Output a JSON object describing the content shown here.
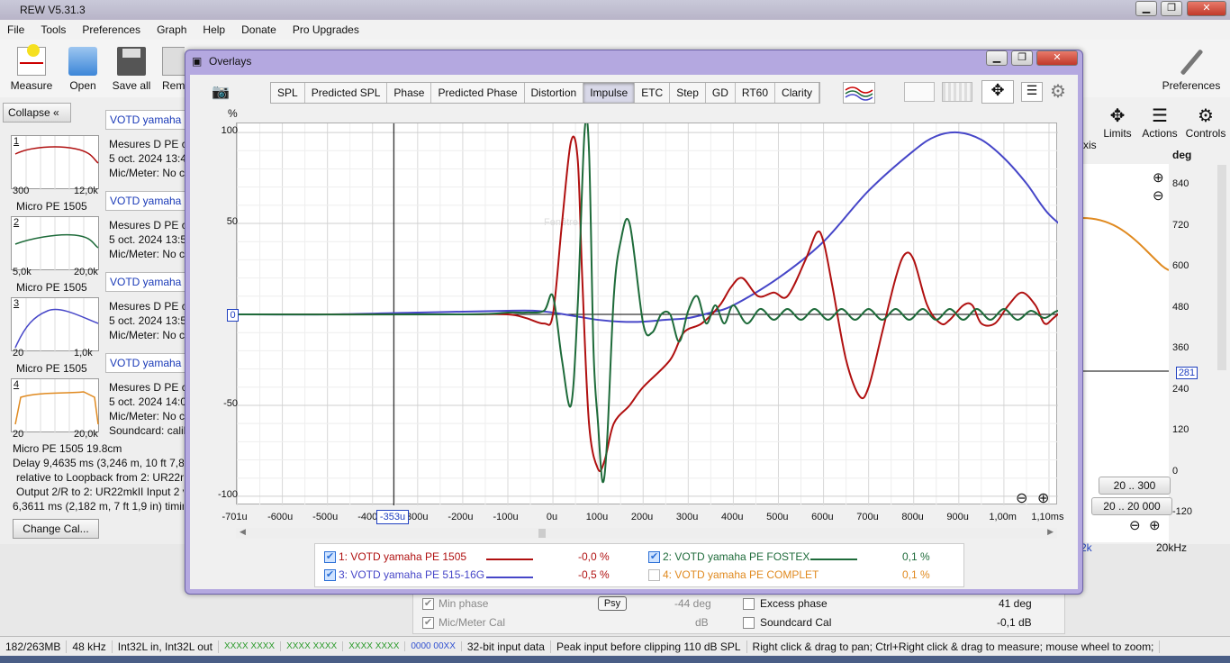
{
  "window": {
    "title": "REW V5.31.3"
  },
  "menu": [
    "File",
    "Tools",
    "Preferences",
    "Graph",
    "Help",
    "Donate",
    "Pro Upgrades"
  ],
  "toolbar": {
    "measure": "Measure",
    "open": "Open",
    "saveall": "Save all",
    "rem": "Rem",
    "preferences": "Preferences",
    "axis": "xis",
    "limits": "Limits",
    "actions": "Actions",
    "controls": "Controls"
  },
  "left": {
    "collapse": "Collapse",
    "measurements": [
      {
        "tab": "VOTD yamaha P",
        "num": "1",
        "l1": "Mesures D PE co",
        "l2": "5 oct. 2024 13:49",
        "l3": "Mic/Meter: No c",
        "lo": "300",
        "hi": "12,0k",
        "name": "Micro PE 1505"
      },
      {
        "tab": "VOTD yamaha P",
        "num": "2",
        "l1": "Mesures D PE co",
        "l2": "5 oct. 2024 13:50",
        "l3": "Mic/Meter: No c",
        "lo": "5,0k",
        "hi": "20,0k",
        "name": "Micro PE 1505"
      },
      {
        "tab": "VOTD yamaha P",
        "num": "3",
        "l1": "Mesures D PE co",
        "l2": "5 oct. 2024 13:55",
        "l3": "Mic/Meter: No c",
        "lo": "20",
        "hi": "1,0k",
        "name": "Micro PE 1505"
      },
      {
        "tab": "VOTD yamaha P",
        "num": "4",
        "l1": "Mesures D PE co",
        "l2": "5 oct. 2024 14:09",
        "l3": "Mic/Meter: No c",
        "l4": "Soundcard: calib",
        "lo": "20",
        "hi": "20,0k",
        "name": ""
      }
    ],
    "micinfo": [
      "Micro PE 1505 19.8cm",
      "Delay 9,4635 ms (3,246 m, 10 ft 7,8 in)",
      "relative to Loopback from 2: UR22mk",
      "Output 2/R to 2: UR22mkII Input 2 v",
      "6,3611 ms (2,182 m, 7 ft 1,9 in) timing"
    ],
    "changecal": "Change Cal..."
  },
  "overlay": {
    "title": "Overlays",
    "tabs": [
      "SPL",
      "Predicted SPL",
      "Phase",
      "Predicted Phase",
      "Distortion",
      "Impulse",
      "ETC",
      "Step",
      "GD",
      "RT60",
      "Clarity"
    ],
    "selected_tab": "Impulse",
    "yunit": "%",
    "unit_select": "%",
    "cursor_label": "-353u",
    "zero_marker": "0",
    "watermark": "Fenêtre"
  },
  "right": {
    "deg": "deg",
    "ticks": [
      "840",
      "720",
      "600",
      "480",
      "360",
      "240",
      "120",
      "0",
      "-120"
    ],
    "marker": "281",
    "range1": "20 .. 300",
    "range2": "20 .. 20 000",
    "hz": "20kHz",
    "k": "2k"
  },
  "bottom": {
    "minphase": "Min phase",
    "psy": "Psy",
    "mp_val": "-44 deg",
    "excess": "Excess phase",
    "ex_val": "41 deg",
    "miccal": "Mic/Meter Cal",
    "db": "dB",
    "soundcard": "Soundcard Cal",
    "sc_val": "-0,1 dB"
  },
  "status": [
    "182/263MB",
    "48 kHz",
    "Int32L in, Int32L out",
    "XXXX XXXX",
    "XXXX XXXX",
    "XXXX XXXX",
    "0000 00XX",
    "32-bit input data",
    "Peak input before clipping 110 dB SPL",
    "Right click & drag to pan; Ctrl+Right click & drag to measure; mouse wheel to zoom;"
  ],
  "colors": {
    "s1": "#b01010",
    "s2": "#1e6b3a",
    "s3": "#4646c8",
    "s4": "#e08a20",
    "status_green": "#2a9a2a",
    "status_blue": "#3050d0"
  },
  "chart_data": {
    "type": "line",
    "xlabel": "",
    "ylabel": "%",
    "xlim": [
      -0.000701,
      0.00112
    ],
    "ylim": [
      -105,
      105
    ],
    "xticks": [
      "-701u",
      "-600u",
      "-500u",
      "-400u",
      "-353u",
      "-300u",
      "-200u",
      "-100u",
      "0u",
      "100u",
      "200u",
      "300u",
      "400u",
      "500u",
      "600u",
      "700u",
      "800u",
      "900u",
      "1,00m",
      "1,10ms"
    ],
    "yticks": [
      "100",
      "50",
      "0",
      "-50",
      "-100"
    ],
    "grid": true,
    "legend_position": "bottom",
    "series": [
      {
        "name": "1: VOTD yamaha PE 1505",
        "value": "-0,0 %",
        "checked": true,
        "color": "#b01010",
        "x": [
          -701,
          -400,
          -200,
          -100,
          -60,
          -20,
          0,
          20,
          40,
          55,
          65,
          80,
          100,
          115,
          135,
          170,
          200,
          260,
          290,
          330,
          370,
          395,
          420,
          455,
          490,
          520,
          560,
          585,
          600,
          620,
          650,
          680,
          700,
          730,
          760,
          780,
          800,
          830,
          860,
          880,
          910,
          930,
          950,
          980,
          1010,
          1040,
          1070,
          1090,
          1110,
          1140,
          1160,
          1172
        ],
        "y": [
          0,
          0,
          0,
          0,
          -2,
          -5,
          0,
          50,
          95,
          85,
          20,
          -60,
          -85,
          -80,
          -60,
          -50,
          -40,
          -25,
          -10,
          -5,
          5,
          15,
          20,
          10,
          12,
          10,
          30,
          45,
          40,
          15,
          -25,
          -45,
          -40,
          -10,
          20,
          33,
          30,
          5,
          -5,
          -3,
          5,
          5,
          -5,
          -5,
          5,
          12,
          5,
          -5,
          -2,
          5,
          12,
          0
        ]
      },
      {
        "name": "2: VOTD yamaha PE FOSTEX",
        "value": "0,1 %",
        "checked": true,
        "color": "#1e6b3a",
        "x": [
          -701,
          -200,
          -100,
          -60,
          -20,
          0,
          20,
          40,
          55,
          70,
          80,
          90,
          100,
          110,
          120,
          135,
          150,
          170,
          200,
          220,
          240,
          260,
          280,
          300,
          320,
          340,
          360,
          380,
          400,
          430,
          460,
          490,
          520,
          550,
          580,
          610,
          640,
          670,
          700,
          730,
          760,
          790,
          820,
          850,
          880,
          910,
          940,
          970,
          1000,
          1030,
          1060,
          1090,
          1120,
          1150,
          1172
        ],
        "y": [
          0,
          0,
          1,
          1,
          2,
          10,
          -25,
          -50,
          5,
          100,
          90,
          -20,
          -60,
          -92,
          -70,
          10,
          40,
          50,
          -5,
          -10,
          0,
          0,
          -15,
          2,
          10,
          -5,
          5,
          -5,
          5,
          -5,
          3,
          -3,
          3,
          -3,
          3,
          -3,
          3,
          -3,
          3,
          -3,
          3,
          -3,
          3,
          -3,
          3,
          -3,
          3,
          -3,
          3,
          -3,
          2,
          -2,
          2,
          -1,
          0
        ]
      },
      {
        "name": "3: VOTD yamaha PE 515-16G",
        "value": "-0,5 %",
        "checked": true,
        "color": "#4646c8",
        "x": [
          -701,
          -500,
          -300,
          -100,
          -40,
          0,
          50,
          100,
          150,
          200,
          250,
          300,
          350,
          400,
          500,
          600,
          700,
          800,
          850,
          900,
          950,
          1000,
          1050,
          1100,
          1172
        ],
        "y": [
          0,
          0,
          1,
          2,
          2,
          1,
          -1,
          -3,
          -4,
          -4,
          -3,
          -2,
          1,
          5,
          20,
          40,
          68,
          90,
          98,
          100,
          96,
          86,
          72,
          55,
          40
        ]
      },
      {
        "name": "4: VOTD yamaha PE COMPLET",
        "value": "0,1 %",
        "checked": false,
        "color": "#e08a20",
        "x": [],
        "y": []
      }
    ]
  }
}
